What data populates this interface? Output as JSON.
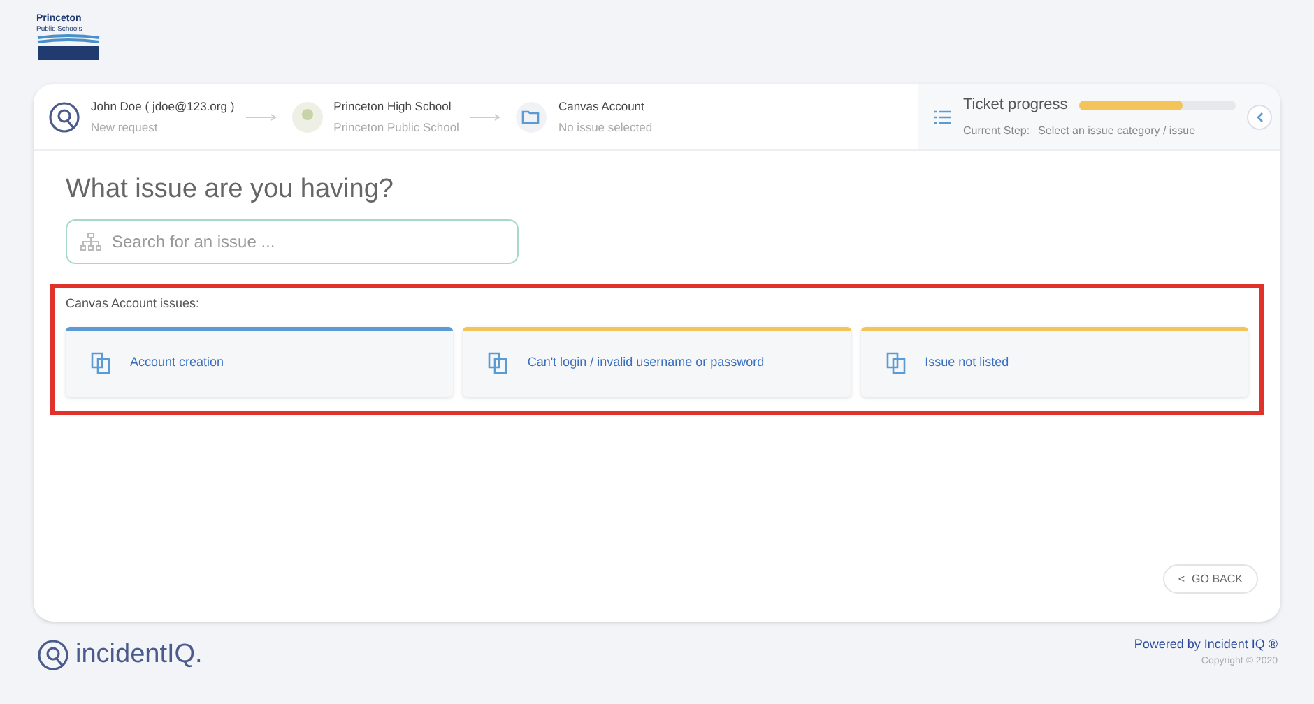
{
  "logo": {
    "line_1": "Princeton",
    "line_2": "Public Schools"
  },
  "breadcrumb": [
    {
      "kind": "user",
      "title": "John Doe ( jdoe@123.org )",
      "subtitle": "New request"
    },
    {
      "kind": "school",
      "title": "Princeton High School",
      "subtitle": "Princeton Public School"
    },
    {
      "kind": "category",
      "title": "Canvas Account",
      "subtitle": "No issue selected"
    }
  ],
  "ticket_progress": {
    "title": "Ticket progress",
    "level": 0.66,
    "step_label": "Current Step:",
    "step": "Select an issue category / issue"
  },
  "heading": "What issue are you having?",
  "search": {
    "placeholder": "Search for an issue ..."
  },
  "issues_label": "Canvas Account issues:",
  "issues": [
    {
      "label": "Account creation",
      "color": "#5b9bd5"
    },
    {
      "label": "Can't login / invalid username or password",
      "color": "#f2c45a"
    },
    {
      "label": "Issue not listed",
      "color": "#f2c45a"
    }
  ],
  "go_back": {
    "icon": "<",
    "label": "GO BACK"
  },
  "footer": {
    "brand": "incidentIQ.",
    "powered_by": "Powered by Incident IQ ®",
    "copyright": "Copyright © 2020"
  }
}
